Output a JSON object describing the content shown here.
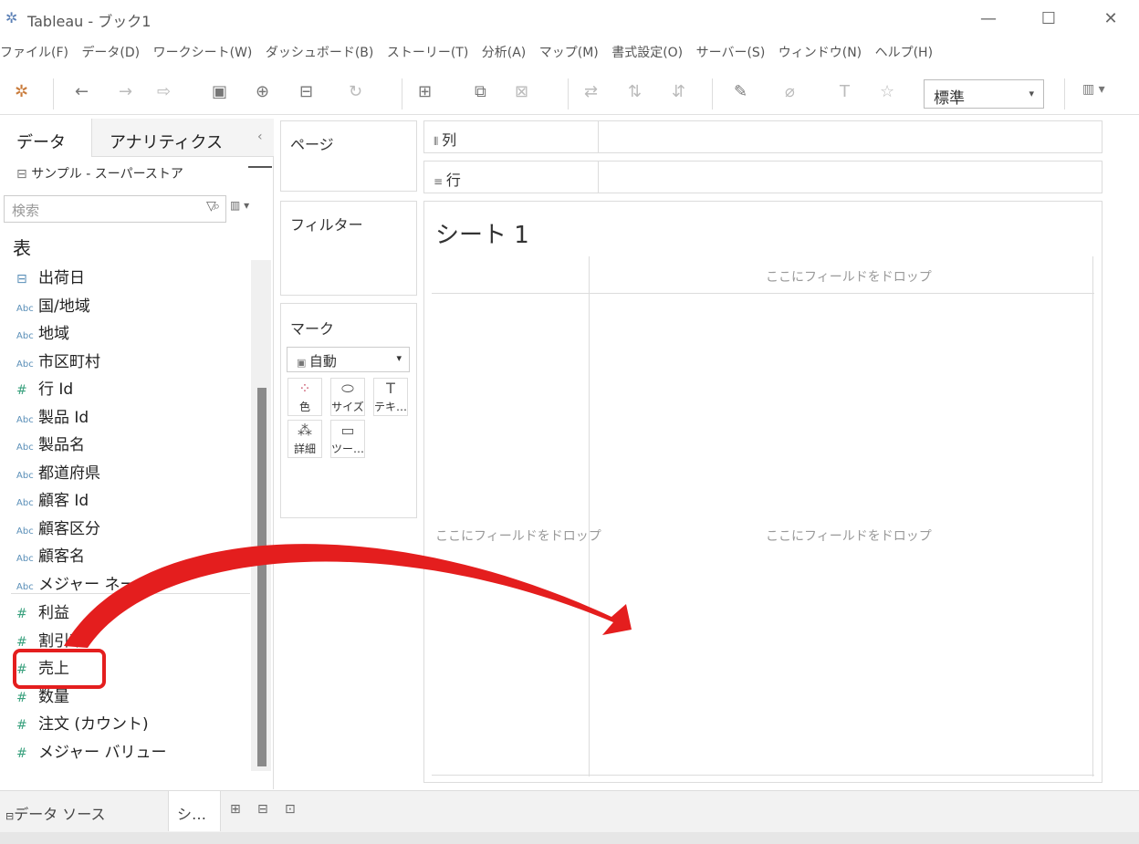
{
  "window": {
    "title": "Tableau - ブック1",
    "minimize": "—",
    "maximize": "☐",
    "close": "✕"
  },
  "menu": [
    "ファイル(F)",
    "データ(D)",
    "ワークシート(W)",
    "ダッシュボード(B)",
    "ストーリー(T)",
    "分析(A)",
    "マップ(M)",
    "書式設定(O)",
    "サーバー(S)",
    "ウィンドウ(N)",
    "ヘルプ(H)"
  ],
  "toolbar": {
    "fit_select": "標準"
  },
  "left_pane": {
    "tab_data": "データ",
    "tab_analytics": "アナリティクス",
    "collapse": "‹",
    "data_source": "サンプル - スーパーストア",
    "search_placeholder": "検索",
    "section_title": "表",
    "dimensions": [
      {
        "type": "date",
        "name": "出荷日"
      },
      {
        "type": "abc",
        "name": "国/地域"
      },
      {
        "type": "abc",
        "name": "地域"
      },
      {
        "type": "abc",
        "name": "市区町村"
      },
      {
        "type": "num",
        "name": "行 Id"
      },
      {
        "type": "abc",
        "name": "製品 Id"
      },
      {
        "type": "abc",
        "name": "製品名"
      },
      {
        "type": "abc",
        "name": "都道府県"
      },
      {
        "type": "abc",
        "name": "顧客 Id"
      },
      {
        "type": "abc",
        "name": "顧客区分"
      },
      {
        "type": "abc",
        "name": "顧客名"
      },
      {
        "type": "abc",
        "name": "メジャー ネーム"
      }
    ],
    "measures": [
      {
        "type": "num",
        "name": "利益"
      },
      {
        "type": "num",
        "name": "割引率"
      },
      {
        "type": "num",
        "name": "売上"
      },
      {
        "type": "num",
        "name": "数量"
      },
      {
        "type": "num",
        "name": "注文 (カウント)"
      },
      {
        "type": "num",
        "name": "メジャー バリュー"
      }
    ],
    "type_labels": {
      "abc": "Abc",
      "num": "#",
      "date": "⊟"
    }
  },
  "shelves": {
    "pages": "ページ",
    "filters": "フィルター",
    "columns": "列",
    "rows": "行",
    "marks": "マーク",
    "marks_type": "自動"
  },
  "marks_buttons": [
    "色",
    "サイズ",
    "テキ…",
    "詳細",
    "ツー…"
  ],
  "canvas": {
    "sheet_title": "シート 1",
    "drop_top": "ここにフィールドをドロップ",
    "drop_left": "ここにフィールドをドロップ",
    "drop_center": "ここにフィールドをドロップ"
  },
  "bottom": {
    "data_source_tab": "データ ソース",
    "sheet_tab": "シ…"
  },
  "colors": {
    "highlight": "#e41e1e",
    "arrow": "#e41e1e"
  }
}
